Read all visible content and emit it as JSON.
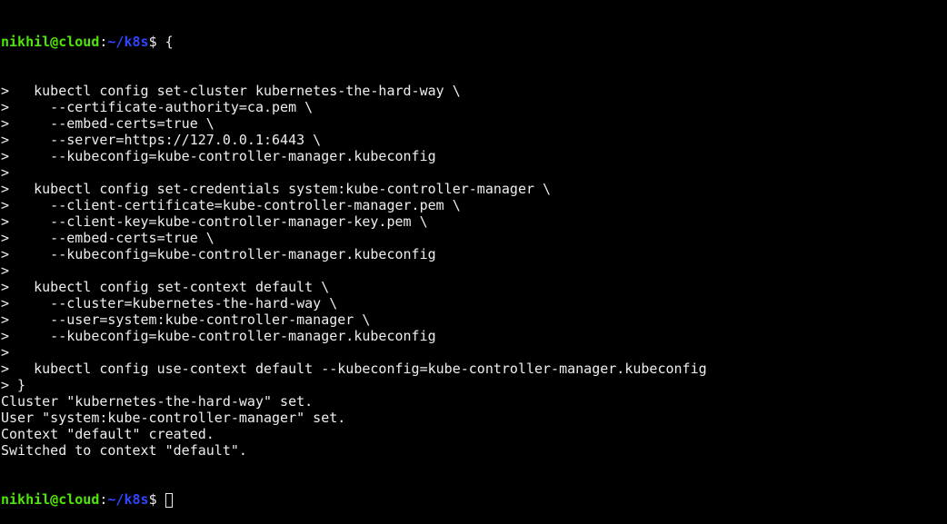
{
  "prompt": {
    "user_host": "nikhil@cloud",
    "sep": ":",
    "path": "~/k8s",
    "symbol": "$"
  },
  "colors": {
    "user_host": "#4ee60a",
    "path": "#2f45ff",
    "text": "#eeeeee",
    "background": "#000000"
  },
  "first_command": " {",
  "lines": [
    ">   kubectl config set-cluster kubernetes-the-hard-way \\",
    ">     --certificate-authority=ca.pem \\",
    ">     --embed-certs=true \\",
    ">     --server=https://127.0.0.1:6443 \\",
    ">     --kubeconfig=kube-controller-manager.kubeconfig",
    ">",
    ">   kubectl config set-credentials system:kube-controller-manager \\",
    ">     --client-certificate=kube-controller-manager.pem \\",
    ">     --client-key=kube-controller-manager-key.pem \\",
    ">     --embed-certs=true \\",
    ">     --kubeconfig=kube-controller-manager.kubeconfig",
    ">",
    ">   kubectl config set-context default \\",
    ">     --cluster=kubernetes-the-hard-way \\",
    ">     --user=system:kube-controller-manager \\",
    ">     --kubeconfig=kube-controller-manager.kubeconfig",
    ">",
    ">   kubectl config use-context default --kubeconfig=kube-controller-manager.kubeconfig",
    "> }",
    "Cluster \"kubernetes-the-hard-way\" set.",
    "User \"system:kube-controller-manager\" set.",
    "Context \"default\" created.",
    "Switched to context \"default\"."
  ]
}
